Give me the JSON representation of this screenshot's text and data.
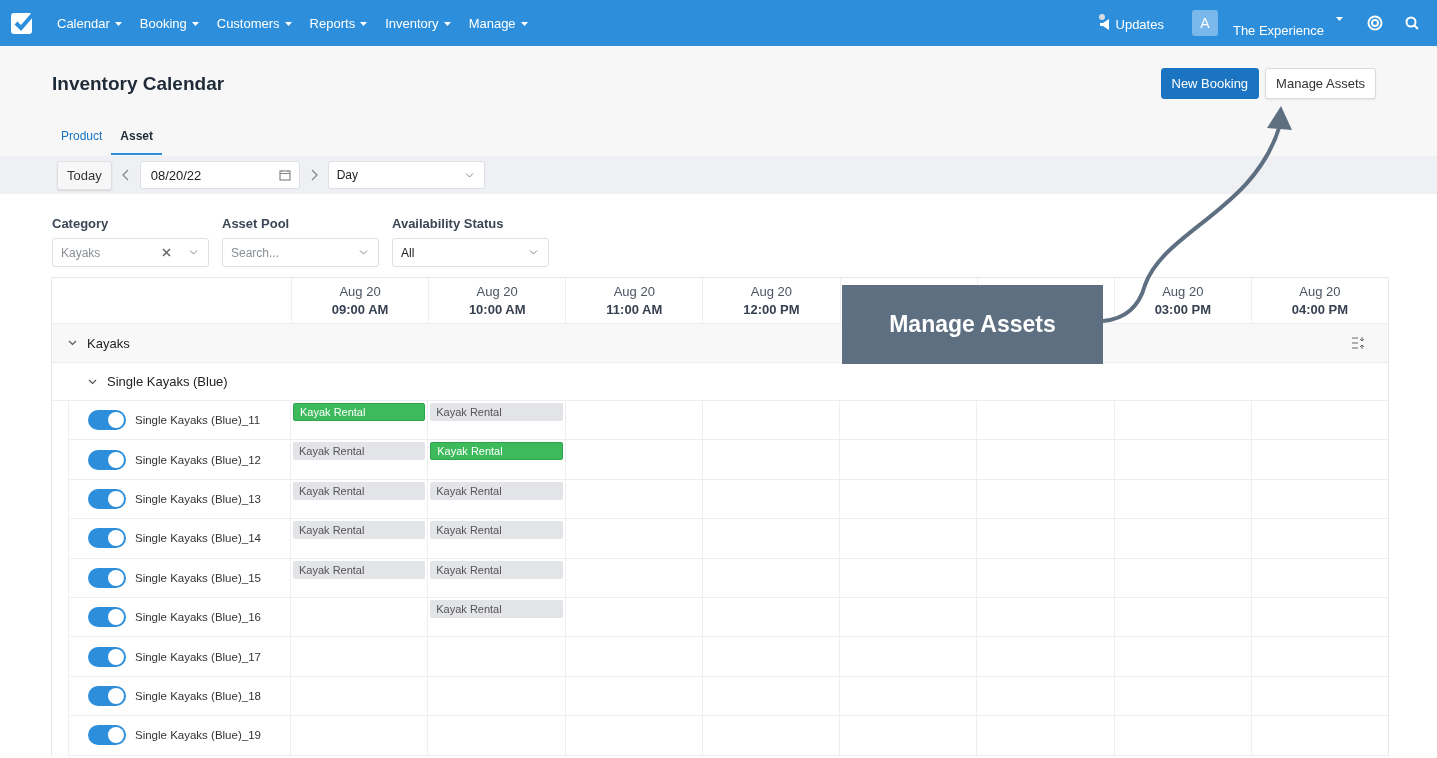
{
  "nav": {
    "menus": [
      "Calendar",
      "Booking",
      "Customers",
      "Reports",
      "Inventory",
      "Manage"
    ],
    "updates": "Updates",
    "avatar": "A",
    "account": "The Experience"
  },
  "page": {
    "title": "Inventory Calendar",
    "buttons": [
      {
        "label": "New Booking",
        "kind": "primary"
      },
      {
        "label": "Manage Assets",
        "kind": "secondary"
      }
    ]
  },
  "tabs": [
    {
      "label": "Product",
      "selected": false
    },
    {
      "label": "Asset",
      "selected": true
    }
  ],
  "toolbar": {
    "today": "Today",
    "date": "08/20/22",
    "view": "Day"
  },
  "filters": [
    {
      "label": "Category",
      "value": "Kayaks",
      "clearable": true
    },
    {
      "label": "Asset Pool",
      "placeholder": "Search...",
      "clearable": false
    },
    {
      "label": "Availability Status",
      "value": "All",
      "clearable": false
    }
  ],
  "columns": [
    {
      "kind": "time",
      "date": "Aug 20",
      "time": "09:00 AM"
    },
    {
      "kind": "time",
      "date": "Aug 20",
      "time": "10:00 AM"
    },
    {
      "kind": "time",
      "date": "Aug 20",
      "time": "11:00 AM"
    },
    {
      "kind": "time",
      "date": "Aug 20",
      "time": "12:00 PM"
    },
    {
      "kind": "covered"
    },
    {
      "kind": "covered"
    },
    {
      "kind": "time",
      "date": "Aug 20",
      "time": "03:00 PM"
    },
    {
      "kind": "time",
      "date": "Aug 20",
      "time": "04:00 PM"
    }
  ],
  "group": {
    "name": "Kayaks",
    "expanded": true,
    "subgroup": {
      "name": "Single Kayaks (Blue)",
      "expanded": true,
      "assets": [
        {
          "name": "Single Kayaks (Blue)_11",
          "on": true,
          "cells": [
            {
              "kind": "active",
              "label": "Kayak Rental"
            },
            {
              "kind": "other",
              "label": "Kayak Rental"
            }
          ]
        },
        {
          "name": "Single Kayaks (Blue)_12",
          "on": true,
          "cells": [
            {
              "kind": "other",
              "label": "Kayak Rental"
            },
            {
              "kind": "active",
              "label": "Kayak Rental"
            }
          ]
        },
        {
          "name": "Single Kayaks (Blue)_13",
          "on": true,
          "cells": [
            {
              "kind": "other",
              "label": "Kayak Rental"
            },
            {
              "kind": "other",
              "label": "Kayak Rental"
            }
          ]
        },
        {
          "name": "Single Kayaks (Blue)_14",
          "on": true,
          "cells": [
            {
              "kind": "other",
              "label": "Kayak Rental"
            },
            {
              "kind": "other",
              "label": "Kayak Rental"
            }
          ]
        },
        {
          "name": "Single Kayaks (Blue)_15",
          "on": true,
          "cells": [
            {
              "kind": "other",
              "label": "Kayak Rental"
            },
            {
              "kind": "other",
              "label": "Kayak Rental"
            }
          ]
        },
        {
          "name": "Single Kayaks (Blue)_16",
          "on": true,
          "cells": [
            {
              "kind": "empty"
            },
            {
              "kind": "other",
              "label": "Kayak Rental"
            }
          ]
        },
        {
          "name": "Single Kayaks (Blue)_17",
          "on": true
        },
        {
          "name": "Single Kayaks (Blue)_18",
          "on": true
        },
        {
          "name": "Single Kayaks (Blue)_19",
          "on": true
        }
      ]
    }
  },
  "callout": {
    "text": "Manage Assets"
  }
}
